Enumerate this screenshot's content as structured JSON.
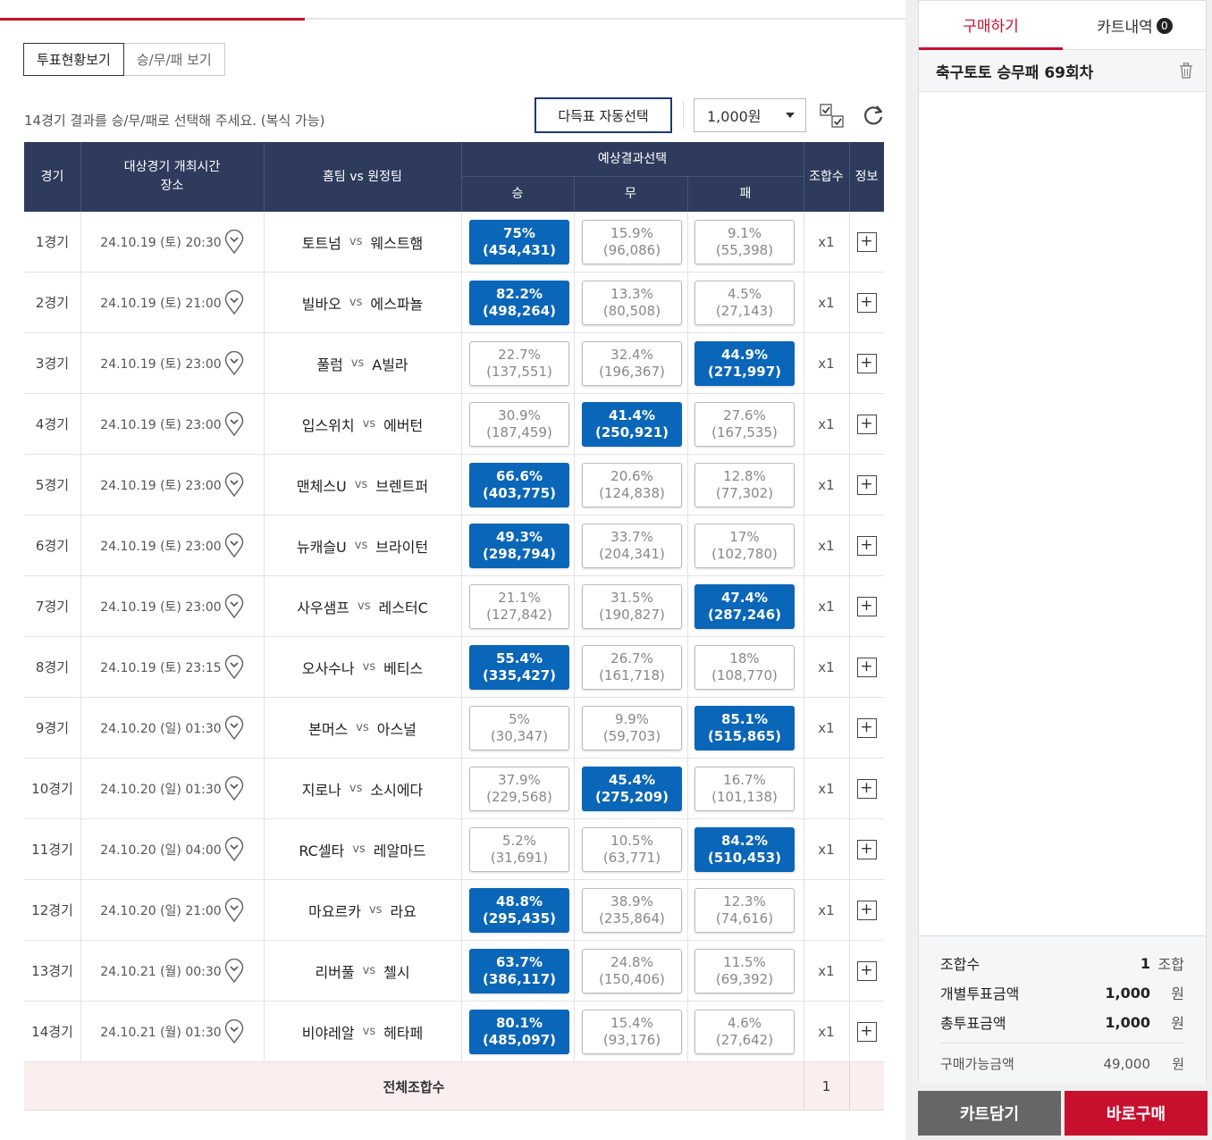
{
  "view_tabs": [
    "투표현황보기",
    "승/무/패 보기"
  ],
  "instruction": "14경기 결과를 승/무/패로 선택해 주세요. (복식 가능)",
  "auto_select_label": "다득표 자동선택",
  "amount_selected": "1,000원",
  "header": {
    "game": "경기",
    "time_line1": "대상경기 개최시간",
    "time_line2": "장소",
    "teams": "홈팀 vs 원정팀",
    "prediction": "예상결과선택",
    "win": "승",
    "draw": "무",
    "lose": "패",
    "combos": "조합수",
    "info": "정보"
  },
  "vs_label": "vs",
  "rows": [
    {
      "game": "1경기",
      "time": "24.10.19 (토) 20:30",
      "home": "토트넘",
      "away": "웨스트햄",
      "win": "75%",
      "win_n": "(454,431)",
      "draw": "15.9%",
      "draw_n": "(96,086)",
      "lose": "9.1%",
      "lose_n": "(55,398)",
      "selected": "win",
      "mult": "x1"
    },
    {
      "game": "2경기",
      "time": "24.10.19 (토) 21:00",
      "home": "빌바오",
      "away": "에스파뇰",
      "win": "82.2%",
      "win_n": "(498,264)",
      "draw": "13.3%",
      "draw_n": "(80,508)",
      "lose": "4.5%",
      "lose_n": "(27,143)",
      "selected": "win",
      "mult": "x1"
    },
    {
      "game": "3경기",
      "time": "24.10.19 (토) 23:00",
      "home": "풀럼",
      "away": "A빌라",
      "win": "22.7%",
      "win_n": "(137,551)",
      "draw": "32.4%",
      "draw_n": "(196,367)",
      "lose": "44.9%",
      "lose_n": "(271,997)",
      "selected": "lose",
      "mult": "x1"
    },
    {
      "game": "4경기",
      "time": "24.10.19 (토) 23:00",
      "home": "입스위치",
      "away": "에버턴",
      "win": "30.9%",
      "win_n": "(187,459)",
      "draw": "41.4%",
      "draw_n": "(250,921)",
      "lose": "27.6%",
      "lose_n": "(167,535)",
      "selected": "draw",
      "mult": "x1"
    },
    {
      "game": "5경기",
      "time": "24.10.19 (토) 23:00",
      "home": "맨체스U",
      "away": "브렌트퍼",
      "win": "66.6%",
      "win_n": "(403,775)",
      "draw": "20.6%",
      "draw_n": "(124,838)",
      "lose": "12.8%",
      "lose_n": "(77,302)",
      "selected": "win",
      "mult": "x1"
    },
    {
      "game": "6경기",
      "time": "24.10.19 (토) 23:00",
      "home": "뉴캐슬U",
      "away": "브라이턴",
      "win": "49.3%",
      "win_n": "(298,794)",
      "draw": "33.7%",
      "draw_n": "(204,341)",
      "lose": "17%",
      "lose_n": "(102,780)",
      "selected": "win",
      "mult": "x1"
    },
    {
      "game": "7경기",
      "time": "24.10.19 (토) 23:00",
      "home": "사우샘프",
      "away": "레스터C",
      "win": "21.1%",
      "win_n": "(127,842)",
      "draw": "31.5%",
      "draw_n": "(190,827)",
      "lose": "47.4%",
      "lose_n": "(287,246)",
      "selected": "lose",
      "mult": "x1"
    },
    {
      "game": "8경기",
      "time": "24.10.19 (토) 23:15",
      "home": "오사수나",
      "away": "베티스",
      "win": "55.4%",
      "win_n": "(335,427)",
      "draw": "26.7%",
      "draw_n": "(161,718)",
      "lose": "18%",
      "lose_n": "(108,770)",
      "selected": "win",
      "mult": "x1"
    },
    {
      "game": "9경기",
      "time": "24.10.20 (일) 01:30",
      "home": "본머스",
      "away": "아스널",
      "win": "5%",
      "win_n": "(30,347)",
      "draw": "9.9%",
      "draw_n": "(59,703)",
      "lose": "85.1%",
      "lose_n": "(515,865)",
      "selected": "lose",
      "mult": "x1"
    },
    {
      "game": "10경기",
      "time": "24.10.20 (일) 01:30",
      "home": "지로나",
      "away": "소시에다",
      "win": "37.9%",
      "win_n": "(229,568)",
      "draw": "45.4%",
      "draw_n": "(275,209)",
      "lose": "16.7%",
      "lose_n": "(101,138)",
      "selected": "draw",
      "mult": "x1"
    },
    {
      "game": "11경기",
      "time": "24.10.20 (일) 04:00",
      "home": "RC셀타",
      "away": "레알마드",
      "win": "5.2%",
      "win_n": "(31,691)",
      "draw": "10.5%",
      "draw_n": "(63,771)",
      "lose": "84.2%",
      "lose_n": "(510,453)",
      "selected": "lose",
      "mult": "x1"
    },
    {
      "game": "12경기",
      "time": "24.10.20 (일) 21:00",
      "home": "마요르카",
      "away": "라요",
      "win": "48.8%",
      "win_n": "(295,435)",
      "draw": "38.9%",
      "draw_n": "(235,864)",
      "lose": "12.3%",
      "lose_n": "(74,616)",
      "selected": "win",
      "mult": "x1"
    },
    {
      "game": "13경기",
      "time": "24.10.21 (월) 00:30",
      "home": "리버풀",
      "away": "첼시",
      "win": "63.7%",
      "win_n": "(386,117)",
      "draw": "24.8%",
      "draw_n": "(150,406)",
      "lose": "11.5%",
      "lose_n": "(69,392)",
      "selected": "win",
      "mult": "x1"
    },
    {
      "game": "14경기",
      "time": "24.10.21 (월) 01:30",
      "home": "비야레알",
      "away": "헤타페",
      "win": "80.1%",
      "win_n": "(485,097)",
      "draw": "15.4%",
      "draw_n": "(93,176)",
      "lose": "4.6%",
      "lose_n": "(27,642)",
      "selected": "win",
      "mult": "x1"
    }
  ],
  "total": {
    "label": "전체조합수",
    "value": "1"
  },
  "side": {
    "tab_buy": "구매하기",
    "tab_cart": "카트내역",
    "cart_count": "0",
    "round_title": "축구토토 승무패 69회차",
    "combos_label": "조합수",
    "combos_value": "1",
    "combos_unit": "조합",
    "single_label": "개별투표금액",
    "single_value": "1,000",
    "single_unit": "원",
    "total_label": "총투표금액",
    "total_value": "1,000",
    "total_unit": "원",
    "avail_label": "구매가능금액",
    "avail_value": "49,000",
    "avail_unit": "원"
  },
  "btn_cart": "카트담기",
  "btn_buy": "바로구매",
  "colors": {
    "accent_red": "#c8102e",
    "selected_blue": "#0a66b8",
    "header_navy": "#2f3b5c"
  }
}
